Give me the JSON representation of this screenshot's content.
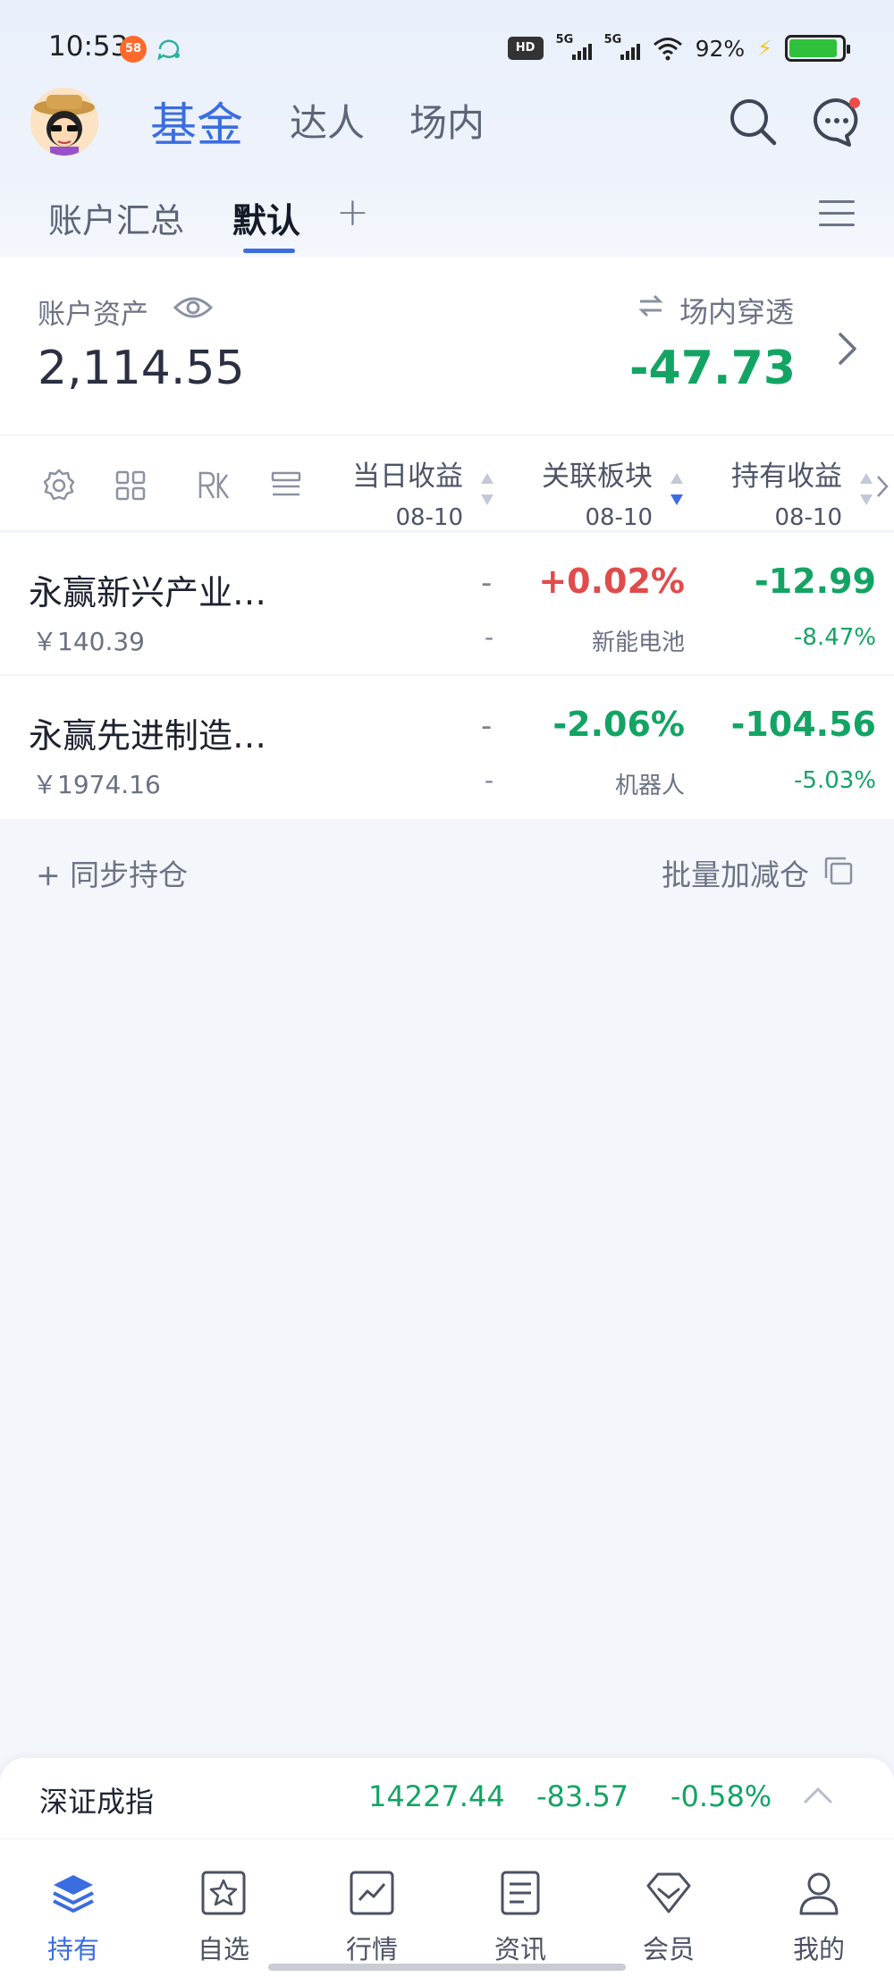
{
  "status_bar": {
    "time": "10:53",
    "app_badge": "58",
    "hd_label": "HD",
    "signal1_label": "5G",
    "signal2_label": "5G",
    "battery_pct": "92%",
    "battery_level": 0.92
  },
  "header": {
    "tabs": [
      {
        "label": "基金",
        "active": true
      },
      {
        "label": "达人",
        "active": false
      },
      {
        "label": "场内",
        "active": false
      }
    ]
  },
  "subtabs": {
    "items": [
      {
        "label": "账户汇总",
        "active": false
      },
      {
        "label": "默认",
        "active": true
      }
    ],
    "add_label": "+"
  },
  "account": {
    "assets_label": "账户资产",
    "assets_value": "2,114.55",
    "penetration_label": "场内穿透",
    "penetration_value": "-47.73"
  },
  "table_header": {
    "columns": [
      {
        "title": "当日收益",
        "date": "08-10"
      },
      {
        "title": "关联板块",
        "date": "08-10"
      },
      {
        "title": "持有收益",
        "date": "08-10"
      }
    ]
  },
  "holdings": [
    {
      "name": "永赢新兴产业…",
      "price": "￥140.39",
      "day_income": "-",
      "day_income_pct": "-",
      "sector_change": "+0.02%",
      "sector_name": "新能电池",
      "hold_income": "-12.99",
      "hold_pct": "-8.47%"
    },
    {
      "name": "永赢先进制造…",
      "price": "￥1974.16",
      "day_income": "-",
      "day_income_pct": "-",
      "sector_change": "-2.06%",
      "sector_name": "机器人",
      "hold_income": "-104.56",
      "hold_pct": "-5.03%"
    }
  ],
  "actions": {
    "sync_label": "+ 同步持仓",
    "batch_label": "批量加减仓"
  },
  "ticker": {
    "name": "深证成指",
    "value": "14227.44",
    "change": "-83.57",
    "change_pct": "-0.58%"
  },
  "bottom_nav": {
    "items": [
      {
        "label": "持有",
        "icon": "layers-icon",
        "active": true
      },
      {
        "label": "自选",
        "icon": "star-icon",
        "active": false
      },
      {
        "label": "行情",
        "icon": "chart-icon",
        "active": false
      },
      {
        "label": "资讯",
        "icon": "document-icon",
        "active": false
      },
      {
        "label": "会员",
        "icon": "diamond-icon",
        "active": false
      },
      {
        "label": "我的",
        "icon": "user-icon",
        "active": false
      }
    ]
  },
  "colors": {
    "accent": "#3a6de0",
    "up_red": "#e14b4b",
    "down_green": "#13a464"
  }
}
